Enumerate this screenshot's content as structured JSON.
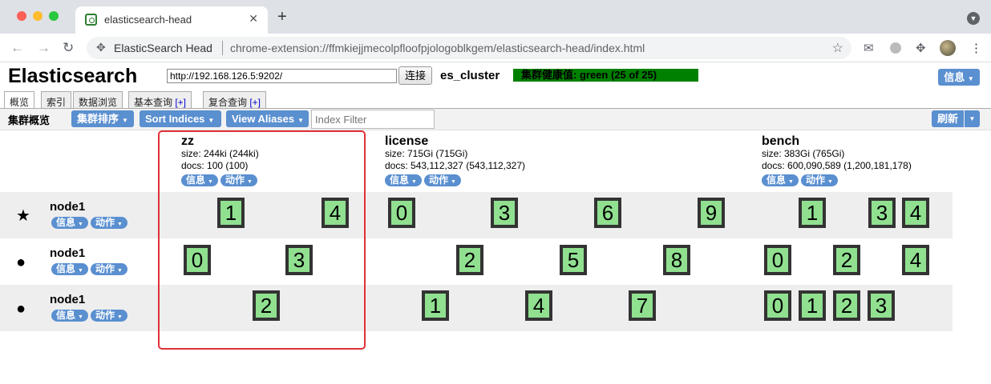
{
  "browser": {
    "tab_title": "elasticsearch-head",
    "tab_close": "✕",
    "new_tab": "+",
    "tab_menu": "▼",
    "nav_back": "←",
    "nav_forward": "→",
    "nav_reload": "↻",
    "extension_name": "ElasticSearch Head",
    "url": "chrome-extension://ffmkiejjmecolpfloofpjologoblkgem/elasticsearch-head/index.html",
    "star_glyph": "☆",
    "mail_glyph": "✉",
    "puzzle_glyph": "✥",
    "menu_glyph": "⋮",
    "ext_glyph": "✥"
  },
  "header": {
    "logo": "Elasticsearch",
    "connect_url": "http://192.168.126.5:9202/",
    "connect_label": "连接",
    "cluster_name": "es_cluster",
    "health": "集群健康值: green (25 of 25)",
    "health_color": "#008000",
    "info_label": "信息",
    "dropdown": "▼"
  },
  "tabs": [
    {
      "label": "概览",
      "plus": ""
    },
    {
      "label": "索引",
      "plus": ""
    },
    {
      "label": "数据浏览",
      "plus": ""
    },
    {
      "label": "基本查询 ",
      "plus": "[+]"
    },
    {
      "label": "复合查询 ",
      "plus": "[+]"
    }
  ],
  "toolbar": {
    "title": "集群概览",
    "sort_cluster": "集群排序",
    "sort_indices": "Sort Indices",
    "view_aliases": "View Aliases",
    "index_filter_placeholder": "Index Filter",
    "refresh": "刷新"
  },
  "index_button_labels": {
    "info": "信息",
    "action": "动作"
  },
  "indices": [
    {
      "name": "zz",
      "size": "size: 244ki (244ki)",
      "docs": "docs: 100 (100)"
    },
    {
      "name": "license",
      "size": "size: 715Gi (715Gi)",
      "docs": "docs: 543,112,327 (543,112,327)"
    },
    {
      "name": "bench",
      "size": "size: 383Gi (765Gi)",
      "docs": "docs: 600,090,589 (1,200,181,178)"
    }
  ],
  "nodes": [
    {
      "name": "node1",
      "icon": "★",
      "master": true
    },
    {
      "name": "node1",
      "icon": "●",
      "master": false
    },
    {
      "name": "node1",
      "icon": "●",
      "master": false
    }
  ],
  "shards": {
    "row1": [
      "1",
      "4",
      "0",
      "3",
      "6",
      "9",
      "1",
      "3",
      "4"
    ],
    "row2": [
      "0",
      "3",
      "2",
      "5",
      "8",
      "0",
      "2",
      "4"
    ],
    "row3": [
      "2",
      "1",
      "4",
      "7",
      "0",
      "1",
      "2",
      "3"
    ]
  },
  "colors": {
    "shard_fill": "#90e090",
    "button_blue": "#5a8fd0",
    "highlight": "#e0303a"
  }
}
